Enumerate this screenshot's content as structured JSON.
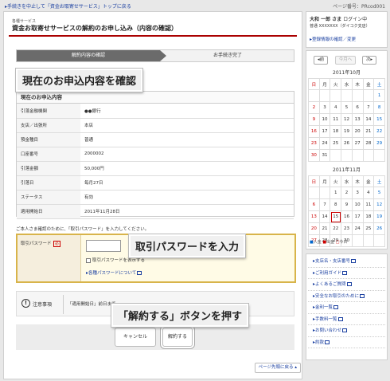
{
  "top": {
    "back_link": "手続きを中止して「資金お取寄せサービス」トップに戻る",
    "page_number": "ページ番号：PRcod001"
  },
  "header": {
    "category": "各種サービス",
    "title": "資金お取寄せサービスの解約のお申し込み（内容の確認）"
  },
  "steps": [
    "解約内容の確認",
    "お手続き完了"
  ],
  "callouts": {
    "current": "現在のお申込内容を確認",
    "password": "取引パスワードを入力",
    "cancel": "「解約する」ボタンを押す"
  },
  "current": {
    "heading": "現在のお申込内容",
    "rows": [
      {
        "label": "引落金融機関",
        "value": "●●銀行"
      },
      {
        "label": "支店／出張所",
        "value": "本店"
      },
      {
        "label": "預金種目",
        "value": "普通"
      },
      {
        "label": "口座番号",
        "value": "2000002"
      },
      {
        "label": "引落金額",
        "value": "50,000円"
      },
      {
        "label": "引落日",
        "value": "毎月27日"
      },
      {
        "label": "ステータス",
        "value": "有効"
      },
      {
        "label": "適用開始日",
        "value": "2011年11月28日"
      }
    ]
  },
  "auth": {
    "note": "ご本人さま確認のために、「取引パスワード」を入力してください。",
    "label": "取引パスワード",
    "required": "必",
    "show_password": "取引パスワードを表示する",
    "about_link": "各種パスワードについて"
  },
  "notice": {
    "label": "注意事項",
    "text": "「適用開始日」前日まで"
  },
  "buttons": {
    "cancel": "キャンセル",
    "submit": "解約する",
    "page_top": "ページ先頭に戻る"
  },
  "user": {
    "name": "大和 一郎 さま",
    "login": "ログイン中",
    "account": "普通 XXXXXXX（ダイコク支店）",
    "edit_link": "登録情報の確認／変更"
  },
  "calendar": {
    "prev": "前",
    "this_month": "今月へ",
    "next": "次",
    "weekdays": [
      "日",
      "月",
      "火",
      "水",
      "木",
      "金",
      "土"
    ],
    "months": [
      {
        "title": "2011年10月",
        "weeks": [
          [
            "",
            "",
            "",
            "",
            "",
            "",
            "1"
          ],
          [
            "2",
            "3",
            "4",
            "5",
            "6",
            "7",
            "8"
          ],
          [
            "9",
            "10",
            "11",
            "12",
            "13",
            "14",
            "15"
          ],
          [
            "16",
            "17",
            "18",
            "19",
            "20",
            "21",
            "22"
          ],
          [
            "23",
            "24",
            "25",
            "26",
            "27",
            "28",
            "29"
          ],
          [
            "30",
            "31",
            "",
            "",
            "",
            "",
            ""
          ]
        ]
      },
      {
        "title": "2011年11月",
        "weeks": [
          [
            "",
            "",
            "1",
            "2",
            "3",
            "4",
            "5"
          ],
          [
            "6",
            "7",
            "8",
            "9",
            "10",
            "11",
            "12"
          ],
          [
            "13",
            "14",
            "15",
            "16",
            "17",
            "18",
            "19"
          ],
          [
            "20",
            "21",
            "22",
            "23",
            "24",
            "25",
            "26"
          ],
          [
            "27",
            "28",
            "29",
            "30",
            "",
            "",
            ""
          ]
        ]
      }
    ],
    "today": "15",
    "legend": [
      "入金",
      "出金",
      "今日"
    ]
  },
  "side_links": [
    "支店名・支店番号",
    "ご利用ガイド",
    "よくあるご質問",
    "安全なお取引のために",
    "金利一覧",
    "手数料一覧",
    "お問い合わせ",
    "約款"
  ]
}
